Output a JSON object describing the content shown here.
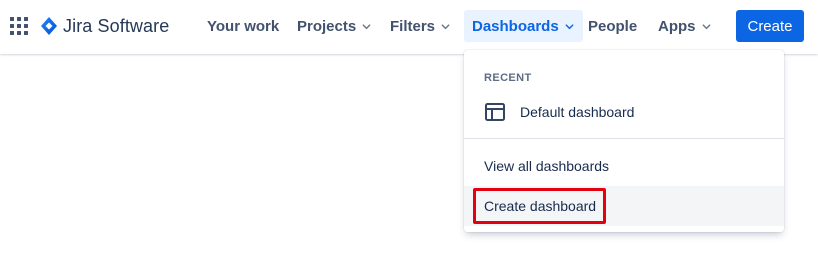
{
  "app": {
    "name": "Jira Software",
    "app_switcher_icon": "grid-icon",
    "logo_icon": "jira-diamond-icon",
    "brand_color": "#0c66e4"
  },
  "nav": {
    "your_work": "Your work",
    "projects": "Projects",
    "filters": "Filters",
    "dashboards": "Dashboards",
    "people": "People",
    "apps": "Apps",
    "create": "Create",
    "active_item": "Dashboards",
    "active_bg_color": "#e9f2ff"
  },
  "dashboards_menu": {
    "recent_heading": "RECENT",
    "recent_items": [
      {
        "label": "Default dashboard",
        "icon": "dashboard-icon"
      }
    ],
    "view_all": "View all dashboards",
    "create_dashboard": "Create dashboard",
    "highlight_color": "#e3000f"
  }
}
